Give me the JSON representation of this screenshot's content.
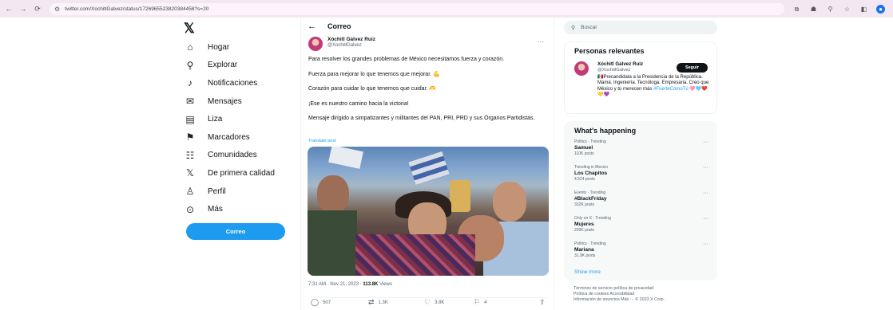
{
  "browser": {
    "url": "twitter.com/XochitlGalvez/status/1726965523820384458?s=20",
    "nav": [
      "←",
      "→",
      "⟳"
    ],
    "extensions": [
      "⧉",
      "☗",
      "⚲",
      "☆",
      "◧",
      "●"
    ]
  },
  "sidebar": {
    "logo": "𝕏",
    "items": [
      {
        "label": "Hogar",
        "icon": "⌂"
      },
      {
        "label": "Explorar",
        "icon": "⚲"
      },
      {
        "label": "Notificaciones",
        "icon": "♪"
      },
      {
        "label": "Mensajes",
        "icon": "✉"
      },
      {
        "label": "Liza",
        "icon": "▤"
      },
      {
        "label": "Marcadores",
        "icon": "⚑"
      },
      {
        "label": "Comunidades",
        "icon": "☷"
      },
      {
        "label": "De primera calidad",
        "icon": "𝕏"
      },
      {
        "label": "Perfil",
        "icon": "♙"
      },
      {
        "label": "Más",
        "icon": "⊙"
      }
    ],
    "post_button": "Correo"
  },
  "main": {
    "back": "←",
    "title": "Correo",
    "author": {
      "name": "Xóchitl Gálvez Ruiz",
      "handle": "@XochitlGalvez"
    },
    "more": "···",
    "tweet": {
      "p1": "Para resolver los grandes problemas de México necesitamos fuerza y corazón.",
      "p2": "Fuerza para mejorar lo que tenemos que mejorar. 💪",
      "p3": "Corazón para cuidar lo que tenemos que cuidar. 🫶",
      "p4": "¡Ese es nuestro camino hacia la victoria!",
      "p5": "Mensaje dirigido a simpatizantes y militantes del PAN, PRI, PRD y sus Órganos Partidistas."
    },
    "translate": "Translate post",
    "time": "7:31 AM · Nov 21, 2023 · ",
    "views_count": "113.8K",
    "views_label": " Views",
    "actions": [
      {
        "icon": "◯",
        "count": "507"
      },
      {
        "icon": "⇄",
        "count": "1.3K"
      },
      {
        "icon": "♡",
        "count": "3.8K"
      },
      {
        "icon": "⚐",
        "count": "4"
      },
      {
        "icon": "⇧",
        "count": ""
      }
    ]
  },
  "right": {
    "search_placeholder": "Buscar",
    "relevant": {
      "title": "Personas relevantes",
      "name": "Xóchitl Gálvez Ruiz",
      "handle": "@XochitlGalvez",
      "follow": "Seguir",
      "bio": "🇲🇽Precandidata a la Presidencia de la República. Mamá. Ingeniería. Tecnóloga. Empresaria. Creo que México y tú merecen más ",
      "bio_tag": "#FuerteComoTú",
      "bio_emoji": " 🩷🩵❤️💛💜"
    },
    "happening": {
      "title": "What's happening",
      "trends": [
        {
          "category": "Politics · Trending",
          "name": "Samuel",
          "count": "110K posts"
        },
        {
          "category": "Trending in Mexico",
          "name": "Los Chapitos",
          "count": "4,524 posts"
        },
        {
          "category": "Events · Trending",
          "name": "#BlackFriday",
          "count": "332K posts"
        },
        {
          "category": "Only on X · Trending",
          "name": "Mujeres",
          "count": "209K posts"
        },
        {
          "category": "Politics · Trending",
          "name": "Mariana",
          "count": "31.9K posts"
        }
      ],
      "more_icon": "···",
      "show_more": "Show more"
    },
    "footer": {
      "line1": "Términos de servicio   política de privacidad",
      "line2": "Política de cookies   Accesibilidad",
      "line3": "Información de anuncios   Más ···   © 2023 X Corp."
    }
  }
}
